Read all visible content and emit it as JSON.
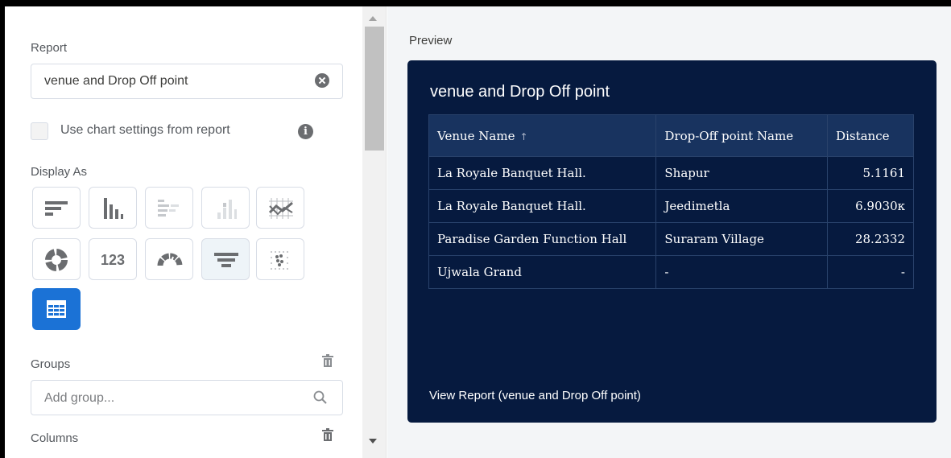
{
  "left_panel": {
    "report_label": "Report",
    "report_value": "venue and Drop Off point",
    "use_chart_settings_label": "Use chart settings from report",
    "display_as_label": "Display As",
    "display_options": [
      "horizontal-bar",
      "vertical-bar",
      "stacked-horizontal-bar",
      "stacked-vertical-bar",
      "line",
      "donut",
      "metric",
      "gauge",
      "funnel",
      "scatter",
      "table"
    ],
    "metric_text": "123",
    "selected_display": "table",
    "groups_label": "Groups",
    "groups_placeholder": "Add group...",
    "columns_label": "Columns"
  },
  "preview": {
    "label": "Preview",
    "card_title": "venue and Drop Off point",
    "columns": [
      "Venue Name",
      "Drop-Off point Name",
      "Distance"
    ],
    "sort_indicator": "↑",
    "rows": [
      [
        "La Royale Banquet Hall.",
        "Shapur",
        "5.1161"
      ],
      [
        "La Royale Banquet Hall.",
        "Jeedimetla",
        "6.9030κ"
      ],
      [
        "Paradise Garden Function Hall",
        "Suraram Village",
        "28.2332"
      ],
      [
        "Ujwala Grand",
        "-",
        "-"
      ]
    ],
    "view_report_link": "View Report (venue and Drop Off point)"
  },
  "colors": {
    "card_bg": "#061a3f",
    "header_bg": "#18335f",
    "accent": "#1b72d6"
  }
}
